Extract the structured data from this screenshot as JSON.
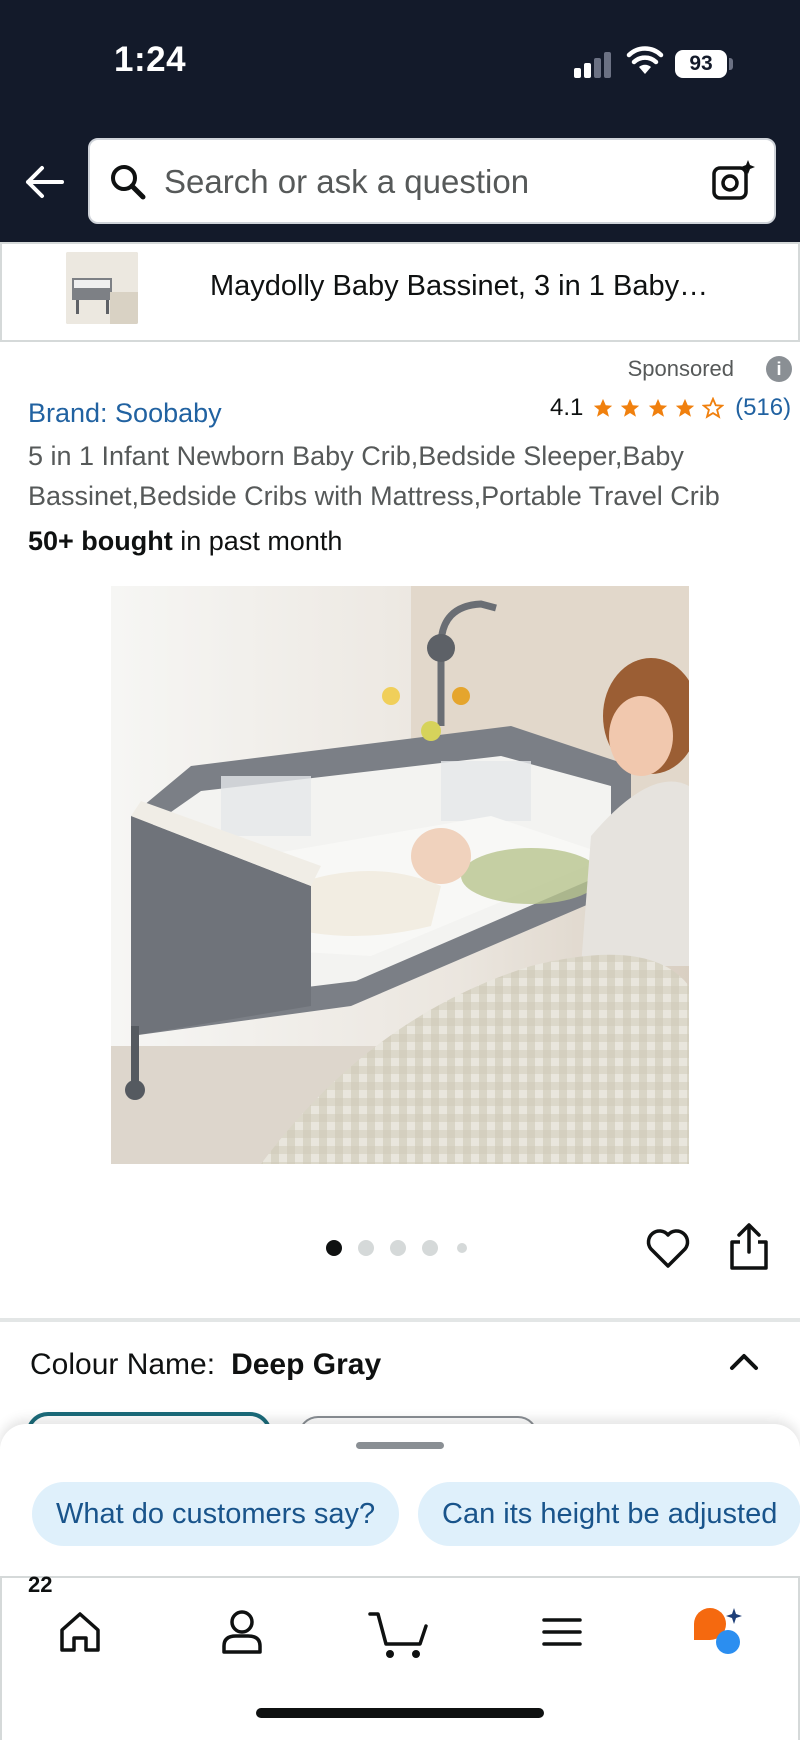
{
  "status_bar": {
    "time": "1:24",
    "battery": "93"
  },
  "header": {
    "search_placeholder": "Search or ask a question"
  },
  "sticky_product": {
    "title": "Maydolly Baby Bassinet, 3 in 1 Baby…"
  },
  "product": {
    "sponsored_label": "Sponsored",
    "brand": "Brand: Soobaby",
    "rating": "4.1",
    "rating_count": "(516)",
    "stars_filled": 4,
    "title": "5 in 1 Infant Newborn Baby Crib,Bedside Sleeper,Baby Bassinet,Bedside Cribs with Mattress,Portable Travel Crib",
    "bought_bold": "50+ bought",
    "bought_rest": " in past month",
    "image_count": 5,
    "active_image": 1
  },
  "variation": {
    "label": "Colour Name:",
    "value": "Deep Gray"
  },
  "suggestions": {
    "chip_1": "What do customers say?",
    "chip_2": "Can its height be adjusted"
  },
  "bottom_nav": {
    "cart_count": "22"
  },
  "colors": {
    "header_bg": "#131a2a",
    "link": "#2162a1",
    "star": "#f0800e",
    "chip_bg": "#dff0fb",
    "chip_text": "#19548b",
    "rufus_orange": "#f5690f",
    "rufus_blue": "#2b8ef0"
  }
}
